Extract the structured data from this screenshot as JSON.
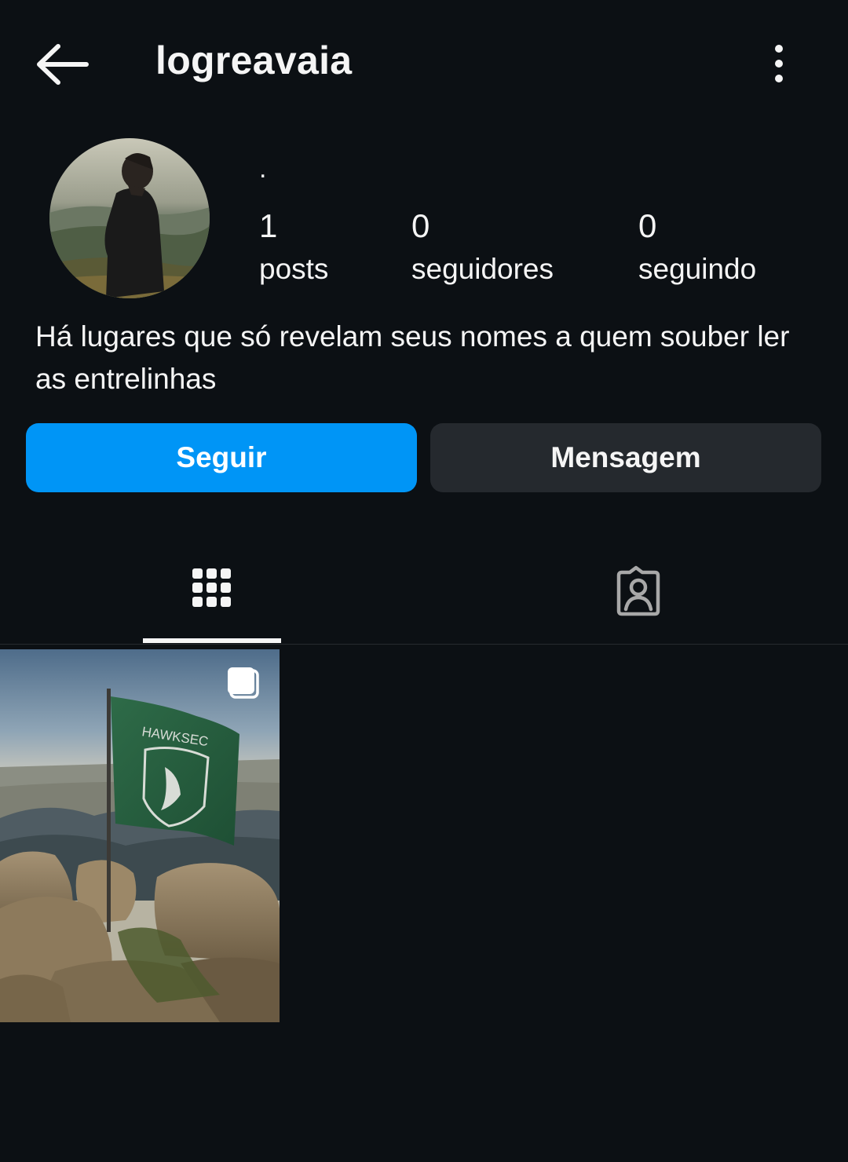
{
  "header": {
    "username": "logreavaia",
    "back_icon": "arrow-left-icon",
    "more_icon": "more-vertical-icon"
  },
  "profile": {
    "display_name": ".",
    "avatar": "profile-photo-person-on-mountain",
    "stats": {
      "posts": {
        "value": "1",
        "label": "posts"
      },
      "followers": {
        "value": "0",
        "label": "seguidores"
      },
      "following": {
        "value": "0",
        "label": "seguindo"
      }
    },
    "bio": "Há lugares que só revelam seus nomes a quem souber ler as entrelinhas"
  },
  "actions": {
    "follow_label": "Seguir",
    "message_label": "Mensagem"
  },
  "tabs": [
    {
      "name": "posts-grid",
      "icon": "grid-icon",
      "active": true
    },
    {
      "name": "tagged",
      "icon": "tagged-person-icon",
      "active": false
    }
  ],
  "posts": [
    {
      "description": "green flag on rocky mountain summit",
      "flag_text": "HAWKSEC",
      "carousel": true
    }
  ],
  "colors": {
    "background": "#0c1014",
    "primary": "#0095f6",
    "secondary_button": "#25292e",
    "text": "#f5f5f5"
  }
}
